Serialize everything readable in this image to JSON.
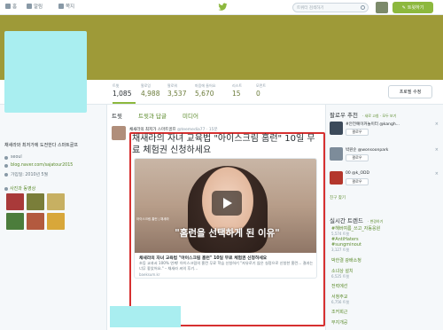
{
  "nav": {
    "home": "홈",
    "notifications": "알림",
    "messages": "쪽지",
    "search_placeholder": "트위터 검색하기",
    "tweet_button": "트윗하기"
  },
  "colors": {
    "accent": "#8db83e",
    "banner": "#9e9a38",
    "profile_placeholder": "#a9eef0",
    "highlight_frame": "#d63030",
    "link": "#5a8a2a"
  },
  "stats": [
    {
      "label": "트윗",
      "value": "1,085"
    },
    {
      "label": "팔로잉",
      "value": "4,988"
    },
    {
      "label": "팔로워",
      "value": "3,537"
    },
    {
      "label": "마음에 들어요",
      "value": "5,670"
    },
    {
      "label": "리스트",
      "value": "15"
    },
    {
      "label": "모먼트",
      "value": "0"
    }
  ],
  "edit_profile_button": "프로필 수정",
  "profile": {
    "bio": "채새라와 최저가에 도전한다 스마트골프",
    "location": "seoul",
    "website": "blog.naver.com/sajatour2015",
    "joined": "가입일: 2010년 5월",
    "photos_title": "사진과 동영상"
  },
  "tabs": [
    {
      "label": "트윗"
    },
    {
      "label": "트윗과 답글"
    },
    {
      "label": "미디어"
    }
  ],
  "tweet": {
    "author_name": "채새라의 최저가 스마트골프",
    "author_handle": "@teemedia77 · 15분",
    "text": "채새라의 자녀 교육법 \"아이스크림 홈런\" 10일 무료 체험권 신청하세요",
    "card": {
      "overlay_text": "\"홈런을 선택하게 된 이유\"",
      "small_text": "아이스크림 홈런 | 채새라",
      "title": "채새라의 자녀 교육법 \"아이스크림 홈런\" 10일 무료 체험권 신청하세요",
      "description": "초등 교과서 100% 연계! 아이스크림의 홈런 무료 학습 신청하기 \"자유로기 않은 실정으로 신청한 홈런… 결과는 너무 좋았어요.\" – 채새라 씨의 후기…",
      "domain": "baeksum.kr"
    }
  },
  "who_to_follow": {
    "title": "팔로우 추천",
    "links": "· 새로 고침 · 모두 보기",
    "follow_label": "팔로우",
    "suggestions": [
      {
        "name": "#안전예이커놀이터 @kangh...",
        "color": "#3c4a5a"
      },
      {
        "name": "박원순 @wonsoonpark",
        "color": "#7d8c9a"
      },
      {
        "name": "00 @k_ODD",
        "color": "#b4372c"
      }
    ],
    "more": "친구 찾기"
  },
  "trends": {
    "title": "실시간 트렌드",
    "change": "· 변경하기",
    "items": [
      {
        "name": "#해버여름_쓰고_자동응원",
        "count": "5,574 트윗"
      },
      {
        "name": "#AntiHaters",
        "count": ""
      },
      {
        "name": "#sungminout",
        "count": "3,127 트윗"
      },
      {
        "name": "박한결 광배소청",
        "count": ""
      },
      {
        "name": "소녀상 설치",
        "count": "6,525 트윗"
      },
      {
        "name": "전력에선",
        "count": ""
      },
      {
        "name": "서청주교",
        "count": "6,756 트윗"
      },
      {
        "name": "조커회근",
        "count": ""
      },
      {
        "name": "무지개공",
        "count": ""
      }
    ]
  }
}
